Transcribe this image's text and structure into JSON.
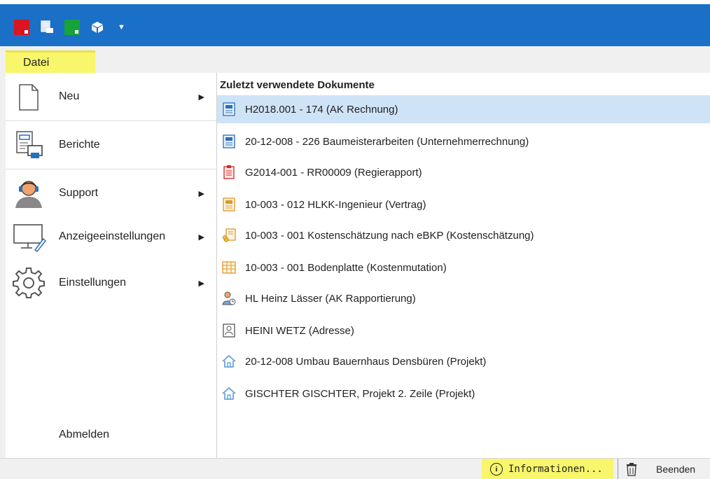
{
  "tabs": {
    "file": "Datei"
  },
  "menu": {
    "items": [
      {
        "label": "Neu",
        "has_submenu": true
      },
      {
        "label": "Berichte",
        "has_submenu": false
      },
      {
        "label": "Support",
        "has_submenu": true
      },
      {
        "label": "Anzeigeeinstellungen",
        "has_submenu": true
      },
      {
        "label": "Einstellungen",
        "has_submenu": true
      }
    ],
    "logout": "Abmelden"
  },
  "recent": {
    "title": "Zuletzt verwendete Dokumente",
    "items": [
      {
        "label": "H2018.001 - 174 (AK Rechnung)",
        "icon": "invoice-icon",
        "selected": true
      },
      {
        "label": "20-12-008 - 226 Baumeisterarbeiten (Unternehmerrechnung)",
        "icon": "invoice-icon",
        "selected": false
      },
      {
        "label": "G2014-001 - RR00009 (Regierapport)",
        "icon": "report-icon",
        "selected": false
      },
      {
        "label": "10-003 - 012 HLKK-Ingenieur (Vertrag)",
        "icon": "contract-icon",
        "selected": false
      },
      {
        "label": "10-003 - 001 Kostenschätzung nach eBKP (Kostenschätzung)",
        "icon": "estimate-icon",
        "selected": false
      },
      {
        "label": "10-003 - 001 Bodenplatte (Kostenmutation)",
        "icon": "mutation-icon",
        "selected": false
      },
      {
        "label": "HL Heinz Lässer (AK Rapportierung)",
        "icon": "person-report-icon",
        "selected": false
      },
      {
        "label": "HEINI WETZ (Adresse)",
        "icon": "address-icon",
        "selected": false
      },
      {
        "label": "20-12-008 Umbau Bauernhaus Densbüren (Projekt)",
        "icon": "project-icon",
        "selected": false
      },
      {
        "label": "GISCHTER GISCHTER, Projekt 2. Zeile (Projekt)",
        "icon": "project-icon",
        "selected": false
      }
    ]
  },
  "status": {
    "info_label": "Informationen...",
    "info_icon": "info-icon",
    "exit_label": "Beenden",
    "exit_icon": "trash-icon"
  },
  "colors": {
    "titlebar": "#1a6fc7",
    "highlight": "#f8f66a",
    "selection": "#cfe3f6"
  }
}
